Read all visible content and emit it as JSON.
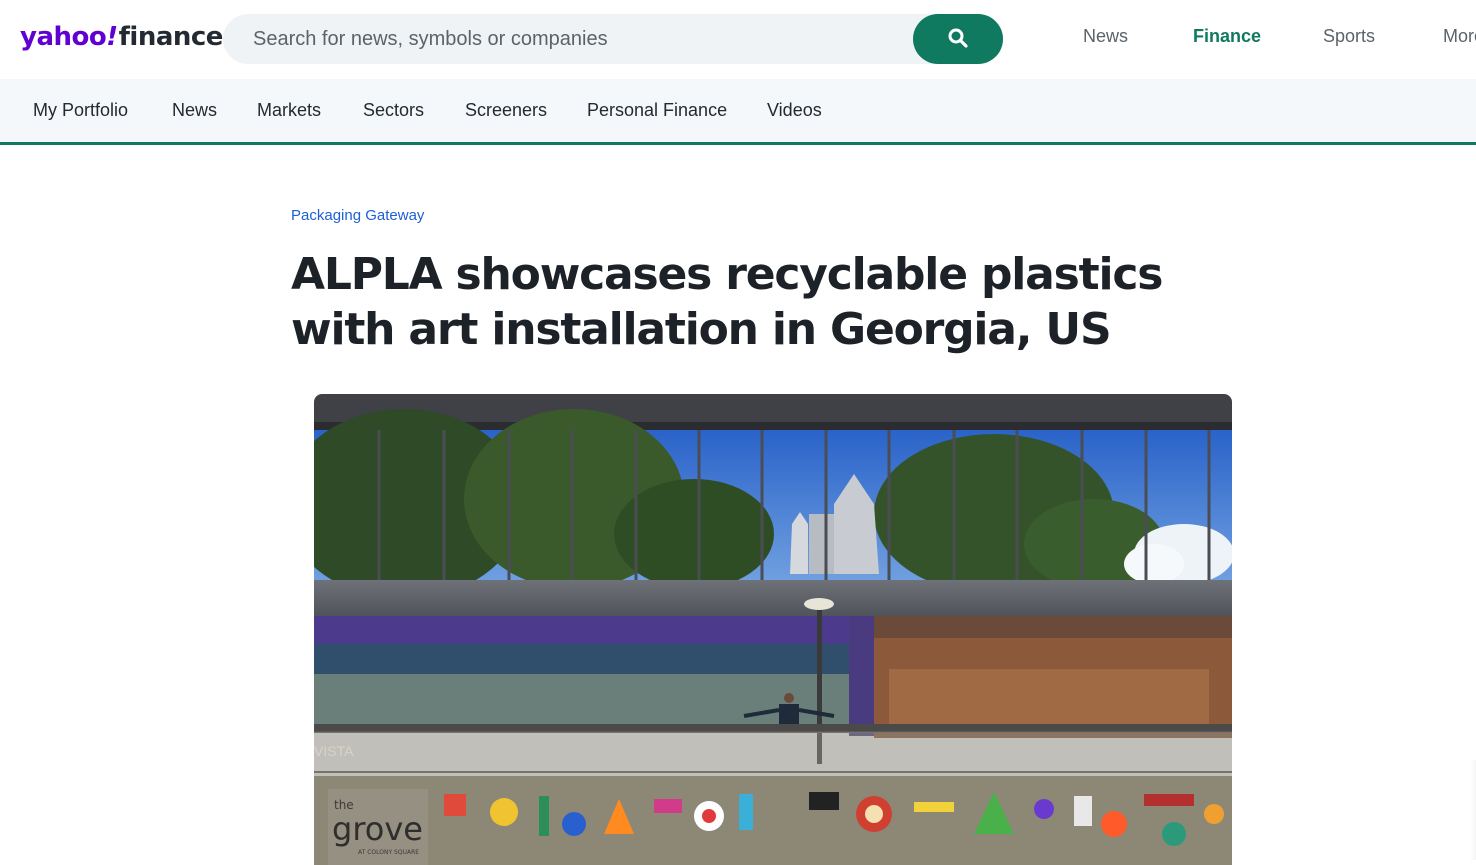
{
  "brand": {
    "logo_main": "yahoo",
    "logo_bang": "!",
    "logo_sub": "finance"
  },
  "search": {
    "placeholder": "Search for news, symbols or companies",
    "value": "",
    "icon": "search-icon"
  },
  "top_nav": [
    {
      "label": "News",
      "active": false
    },
    {
      "label": "Finance",
      "active": true
    },
    {
      "label": "Sports",
      "active": false
    },
    {
      "label": "More",
      "active": false
    }
  ],
  "sub_nav": [
    {
      "label": "My Portfolio"
    },
    {
      "label": "News"
    },
    {
      "label": "Markets"
    },
    {
      "label": "Sectors"
    },
    {
      "label": "Screeners"
    },
    {
      "label": "Personal Finance"
    },
    {
      "label": "Videos"
    }
  ],
  "article": {
    "source": "Packaging Gateway",
    "headline_line1": "ALPLA showcases recyclable plastics",
    "headline_line2": "with art installation in Georgia, US"
  },
  "image_signage": {
    "sign_small": "the",
    "sign_large": "grove",
    "sign_sub": "AT COLONY SQUARE",
    "partial_text": "VISTA"
  },
  "colors": {
    "accent": "#0f7a5f",
    "brand_purple": "#6001d2",
    "link_blue": "#1e5fd6",
    "text_dark": "#1d2228"
  }
}
